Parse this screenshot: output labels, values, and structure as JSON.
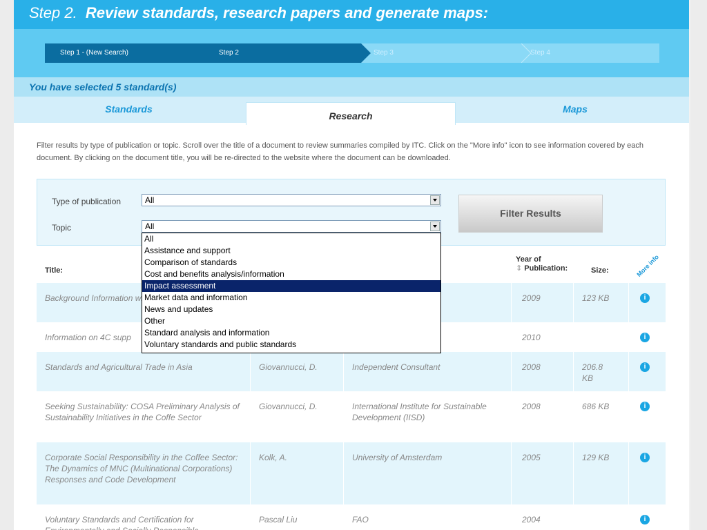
{
  "header": {
    "step_label": "Step 2.",
    "title": "Review standards, research papers and generate maps:"
  },
  "steps": [
    "Step 1 - (New Search)",
    "Step 2",
    "Step 3",
    "Step 4"
  ],
  "selection": {
    "text": "You have selected 5 standard(s)"
  },
  "tabs": {
    "standards": "Standards",
    "research": "Research",
    "maps": "Maps"
  },
  "description": "Filter results by type of publication or topic. Scroll over the title of a document to review summaries compiled by ITC. Click on the \"More info\" icon to see information covered by each document. By clicking on the document title, you will be re-directed to the website where the document can be downloaded.",
  "filters": {
    "type_label": "Type of publication",
    "type_value": "All",
    "topic_label": "Topic",
    "topic_value": "All",
    "button": "Filter Results",
    "topic_options": [
      "All",
      "Assistance and support",
      "Comparison of standards",
      "Cost and benefits analysis/information",
      "Impact assessment",
      "Market data and information",
      "News and updates",
      "Other",
      "Standard analysis and information",
      "Voluntary standards and public standards"
    ],
    "highlighted_option": "Impact assessment"
  },
  "table": {
    "headers": {
      "title": "Title:",
      "year": "Year of",
      "year2": "Publication:",
      "sort_icon": "⇕",
      "size": "Size:",
      "more_info": "More info"
    },
    "rows": [
      {
        "title": "Background Information with Rainforest Alliance",
        "author": "",
        "org": "",
        "year": "2009",
        "size": "123 KB"
      },
      {
        "title": "Information on 4C supp",
        "author": "",
        "org": "",
        "year": "2010",
        "size": ""
      },
      {
        "title": "Standards and Agricultural Trade in Asia",
        "author": "Giovannucci, D.",
        "org": "Independent Consultant",
        "year": "2008",
        "size": "206.8 KB"
      },
      {
        "title": "Seeking Sustainability: COSA Preliminary Analysis of Sustainability Initiatives in the Coffe Sector",
        "author": "Giovannucci, D.",
        "org": "International Institute for Sustainable Development (IISD)",
        "year": "2008",
        "size": "686 KB"
      },
      {
        "title": "Corporate Social Responsibility in the Coffee Sector: The Dynamics of MNC (Multinational Corporations) Responses and Code Development",
        "author": "Kolk, A.",
        "org": "University of Amsterdam",
        "year": "2005",
        "size": "129 KB"
      },
      {
        "title": "Voluntary Standards and Certification for Environmentally and Socially Responsible",
        "author": "Pascal Liu",
        "org": "FAO",
        "year": "2004",
        "size": ""
      }
    ]
  },
  "colors": {
    "header": "#29b0e8",
    "active_step": "#0b6da0",
    "accent": "#1a98d8",
    "highlight": "#0a246a"
  },
  "icons": {
    "info": "info-icon",
    "dropdown_arrow": "chevron-down-icon",
    "sort": "sort-icon"
  }
}
